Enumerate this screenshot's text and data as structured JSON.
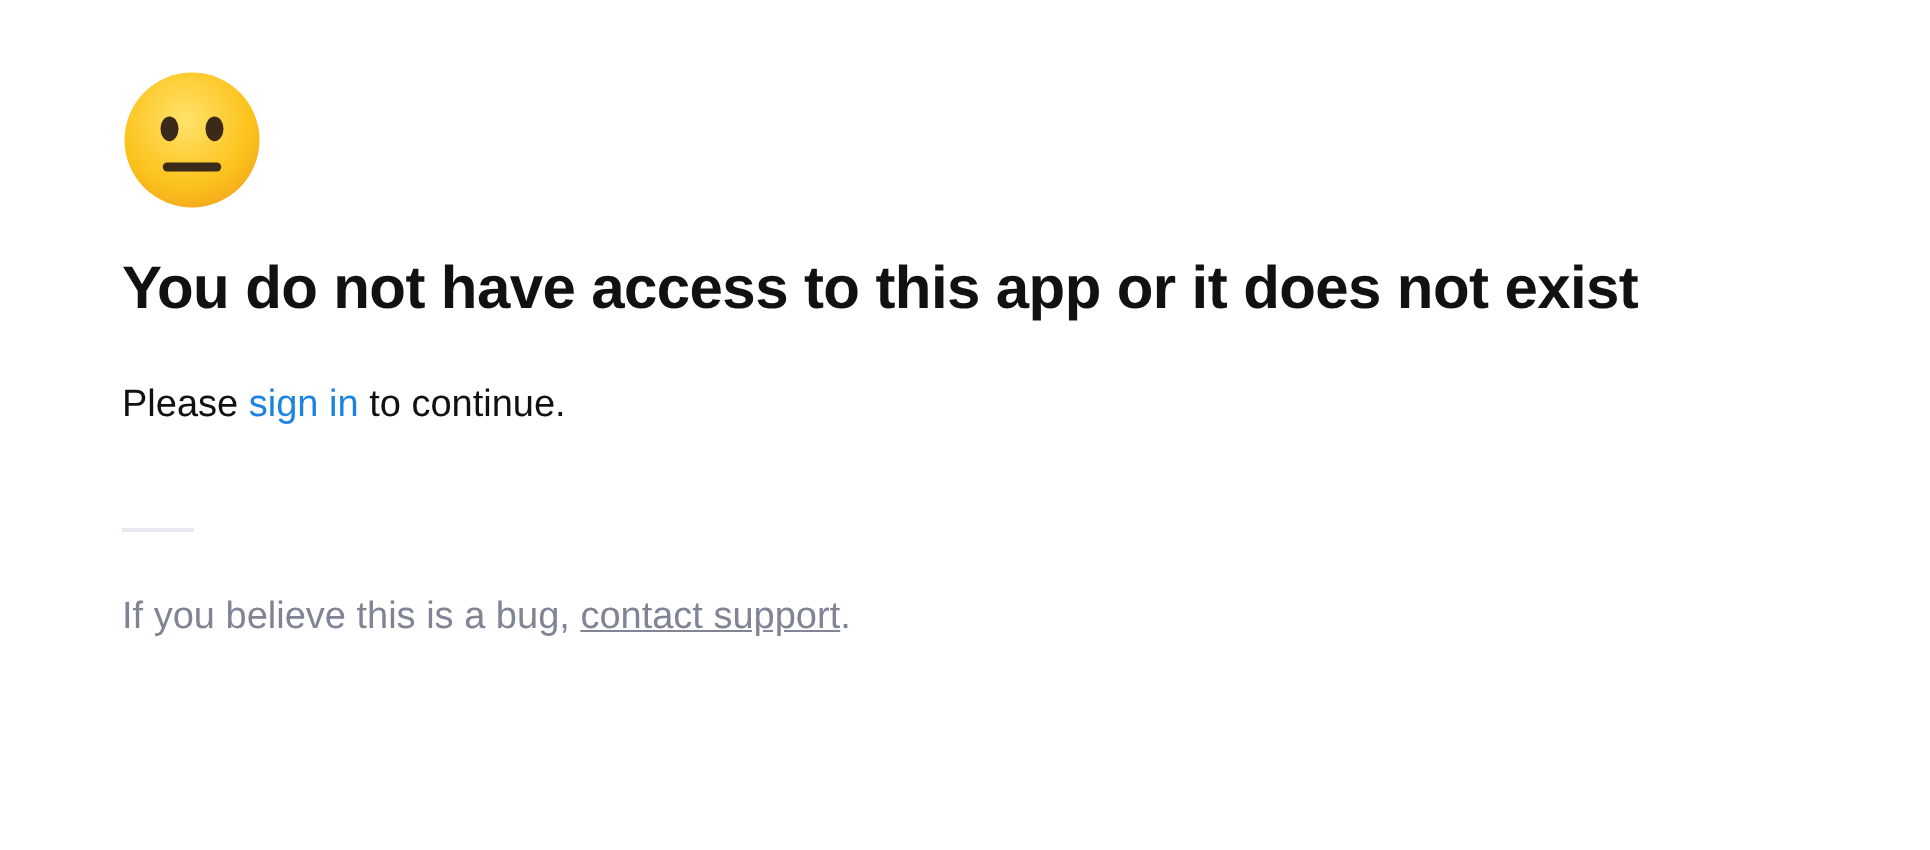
{
  "heading": "You do not have access to this app or it does not exist",
  "message": {
    "before": "Please ",
    "link": "sign in",
    "after": " to continue."
  },
  "footer": {
    "before": "If you believe this is a bug, ",
    "link": "contact support",
    "after": "."
  }
}
